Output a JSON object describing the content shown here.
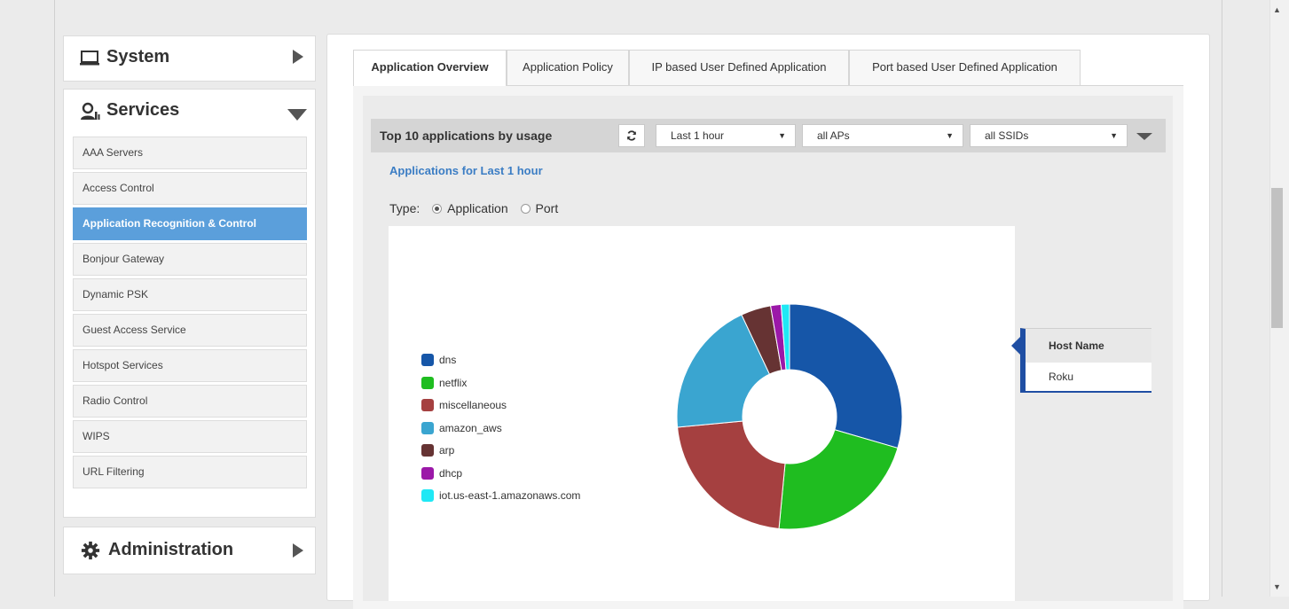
{
  "nav": {
    "system_label": "System",
    "services_label": "Services",
    "admin_label": "Administration",
    "services_items": [
      {
        "label": "AAA Servers"
      },
      {
        "label": "Access Control"
      },
      {
        "label": "Application Recognition & Control",
        "active": true
      },
      {
        "label": "Bonjour Gateway"
      },
      {
        "label": "Dynamic PSK"
      },
      {
        "label": "Guest Access Service"
      },
      {
        "label": "Hotspot Services"
      },
      {
        "label": "Radio Control"
      },
      {
        "label": "WIPS"
      },
      {
        "label": "URL Filtering"
      }
    ]
  },
  "tabs": [
    {
      "label": "Application Overview",
      "active": true
    },
    {
      "label": "Application Policy"
    },
    {
      "label": "IP based User Defined Application"
    },
    {
      "label": "Port based User Defined Application"
    }
  ],
  "toolbar": {
    "title": "Top 10 applications by usage",
    "refresh_icon": "refresh-icon",
    "time_select": "Last 1 hour",
    "ap_select": "all APs",
    "ssid_select": "all SSIDs"
  },
  "content": {
    "subtitle": "Applications for Last 1 hour",
    "type_label": "Type:",
    "type_options": [
      {
        "label": "Application",
        "checked": true
      },
      {
        "label": "Port",
        "checked": false
      }
    ]
  },
  "chart_data": {
    "type": "pie",
    "donut": true,
    "categories": [
      "dns",
      "netflix",
      "miscellaneous",
      "amazon_aws",
      "arp",
      "dhcp",
      "iot.us-east-1.amazonaws.com"
    ],
    "values": [
      29.5,
      22.0,
      22.0,
      19.5,
      4.3,
      1.5,
      1.2
    ],
    "colors": [
      "#1656a8",
      "#1fbd20",
      "#a54040",
      "#3aa5d0",
      "#663333",
      "#9b18a8",
      "#1fe8f5"
    ],
    "legend_position": "left",
    "title": ""
  },
  "tooltip": {
    "header": "Host Name",
    "value": "Roku"
  }
}
